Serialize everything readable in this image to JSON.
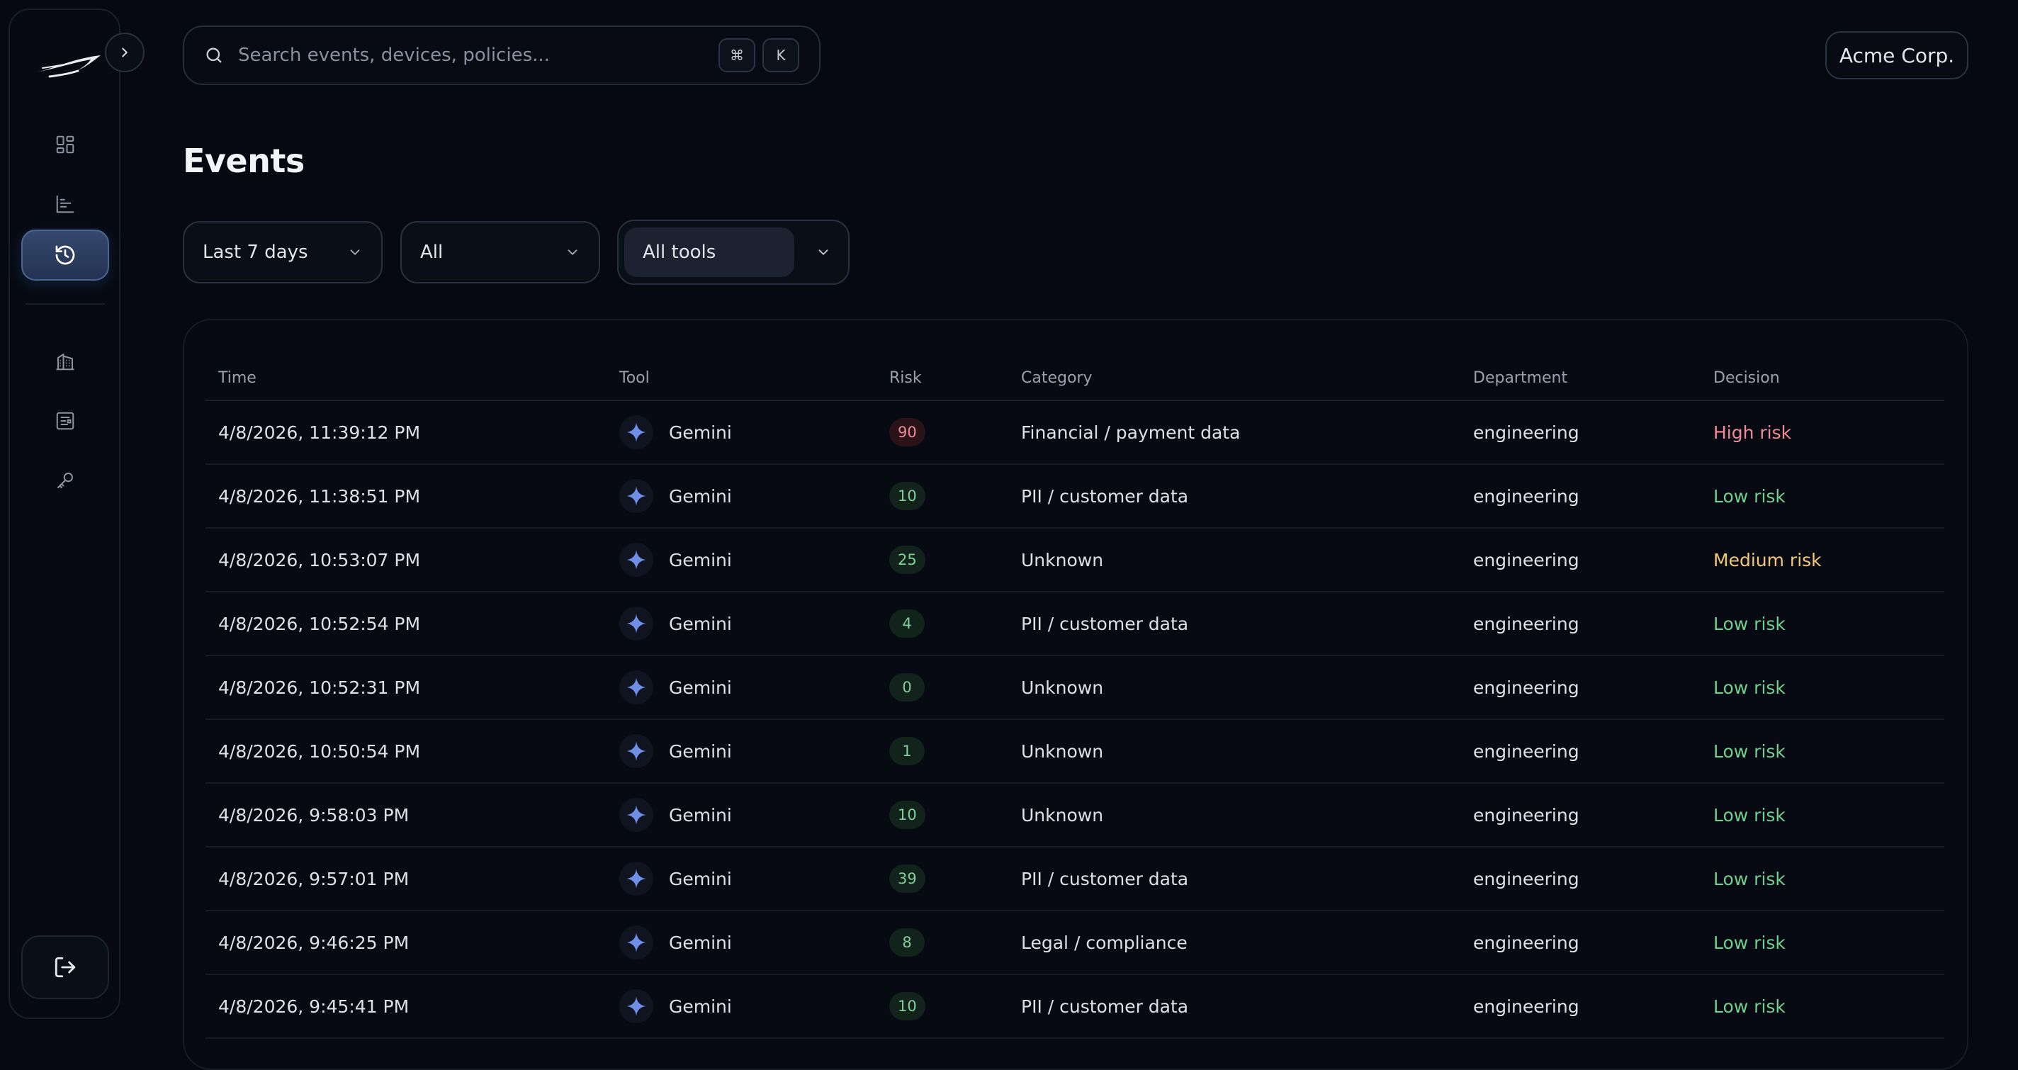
{
  "sidebar": {
    "nav": [
      {
        "icon": "dashboard-grid-icon"
      },
      {
        "icon": "bar-chart-icon"
      },
      {
        "icon": "history-icon",
        "active": true
      },
      {
        "icon": "building-icon"
      },
      {
        "icon": "policy-list-icon"
      },
      {
        "icon": "key-icon"
      }
    ],
    "logout_icon": "logout-icon"
  },
  "search": {
    "placeholder": "Search events, devices, policies...",
    "shortcut_mod": "⌘",
    "shortcut_key": "K"
  },
  "org": {
    "label": "Acme Corp."
  },
  "page": {
    "title": "Events"
  },
  "filters": {
    "time_range": "Last 7 days",
    "decision": "All",
    "tool": "All tools"
  },
  "table": {
    "headers": {
      "time": "Time",
      "tool": "Tool",
      "risk": "Risk",
      "category": "Category",
      "department": "Department",
      "decision": "Decision"
    },
    "rows": [
      {
        "time": "4/8/2026, 11:39:12 PM",
        "tool": "Gemini",
        "risk": "90",
        "category": "Financial / payment data",
        "department": "engineering",
        "decision": "High risk",
        "level": "high"
      },
      {
        "time": "4/8/2026, 11:38:51 PM",
        "tool": "Gemini",
        "risk": "10",
        "category": "PII / customer data",
        "department": "engineering",
        "decision": "Low risk",
        "level": "low"
      },
      {
        "time": "4/8/2026, 10:53:07 PM",
        "tool": "Gemini",
        "risk": "25",
        "category": "Unknown",
        "department": "engineering",
        "decision": "Medium risk",
        "level": "medium"
      },
      {
        "time": "4/8/2026, 10:52:54 PM",
        "tool": "Gemini",
        "risk": "4",
        "category": "PII / customer data",
        "department": "engineering",
        "decision": "Low risk",
        "level": "low"
      },
      {
        "time": "4/8/2026, 10:52:31 PM",
        "tool": "Gemini",
        "risk": "0",
        "category": "Unknown",
        "department": "engineering",
        "decision": "Low risk",
        "level": "low"
      },
      {
        "time": "4/8/2026, 10:50:54 PM",
        "tool": "Gemini",
        "risk": "1",
        "category": "Unknown",
        "department": "engineering",
        "decision": "Low risk",
        "level": "low"
      },
      {
        "time": "4/8/2026, 9:58:03 PM",
        "tool": "Gemini",
        "risk": "10",
        "category": "Unknown",
        "department": "engineering",
        "decision": "Low risk",
        "level": "low"
      },
      {
        "time": "4/8/2026, 9:57:01 PM",
        "tool": "Gemini",
        "risk": "39",
        "category": "PII / customer data",
        "department": "engineering",
        "decision": "Low risk",
        "level": "low"
      },
      {
        "time": "4/8/2026, 9:46:25 PM",
        "tool": "Gemini",
        "risk": "8",
        "category": "Legal / compliance",
        "department": "engineering",
        "decision": "Low risk",
        "level": "low"
      },
      {
        "time": "4/8/2026, 9:45:41 PM",
        "tool": "Gemini",
        "risk": "10",
        "category": "PII / customer data",
        "department": "engineering",
        "decision": "Low risk",
        "level": "low"
      }
    ]
  },
  "colors": {
    "accent": "#4a6594",
    "high": "#f08a96",
    "low": "#6fcf8e",
    "medium": "#f2c874",
    "gemini": "#6f8fe6"
  }
}
